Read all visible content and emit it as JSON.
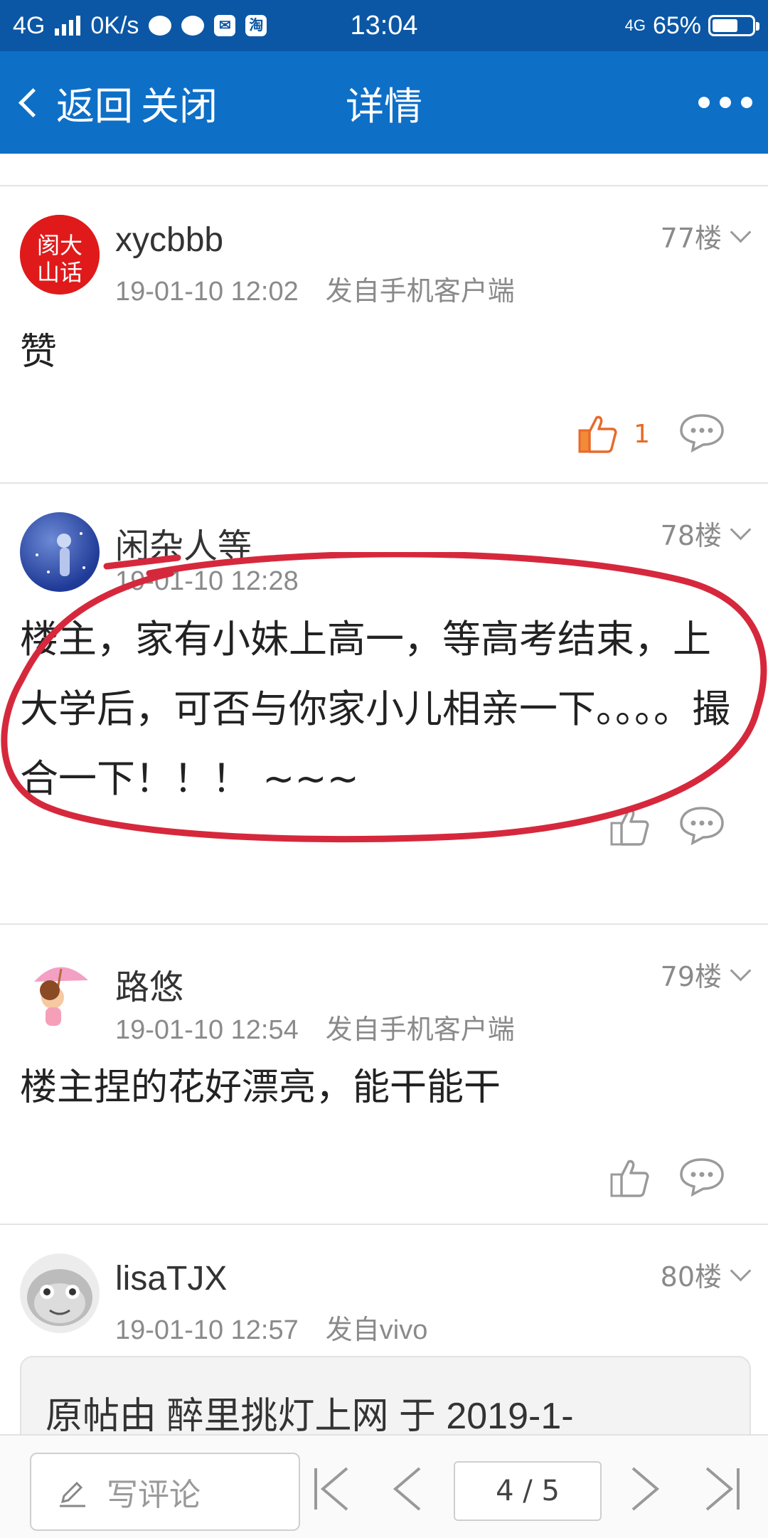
{
  "status_bar": {
    "network": "4G",
    "speed": "0K/s",
    "shop_badge": "淘",
    "time": "13:04",
    "network_right": "4G",
    "battery": "65%",
    "battery_level": 0.65
  },
  "nav": {
    "back_label": "返回",
    "close_label": "关闭",
    "title": "详情"
  },
  "posts": [
    {
      "author": "xycbbb",
      "date": "19-01-10 12:02",
      "source": "发自手机客户端",
      "floor": "77楼",
      "content": "赞",
      "likes": "1",
      "avatar_text": "大山话"
    },
    {
      "author": "闲杂人等",
      "date": "19-01-10 12:28",
      "source": "",
      "floor": "78楼",
      "content": "楼主，家有小妹上高一，等高考结束，上大学后，可否与你家小儿相亲一下。。。。撮合一下！！！ ~~~",
      "likes": ""
    },
    {
      "author": "路悠",
      "date": "19-01-10 12:54",
      "source": "发自手机客户端",
      "floor": "79楼",
      "content": "楼主捏的花好漂亮，能干能干",
      "likes": ""
    },
    {
      "author": "lisaTJX",
      "date": "19-01-10 12:57",
      "source": "发自vivo",
      "floor": "80楼",
      "quote": "原帖由 醉里挑灯上网 于 2019-1-"
    }
  ],
  "bottom_bar": {
    "write_comment": "写评论",
    "page_indicator": "4 / 5"
  },
  "colors": {
    "status_bar": "#0b57a5",
    "nav_bar": "#0e6fc7",
    "like_active": "#e86a2a",
    "annotation_red": "#d6283c"
  }
}
